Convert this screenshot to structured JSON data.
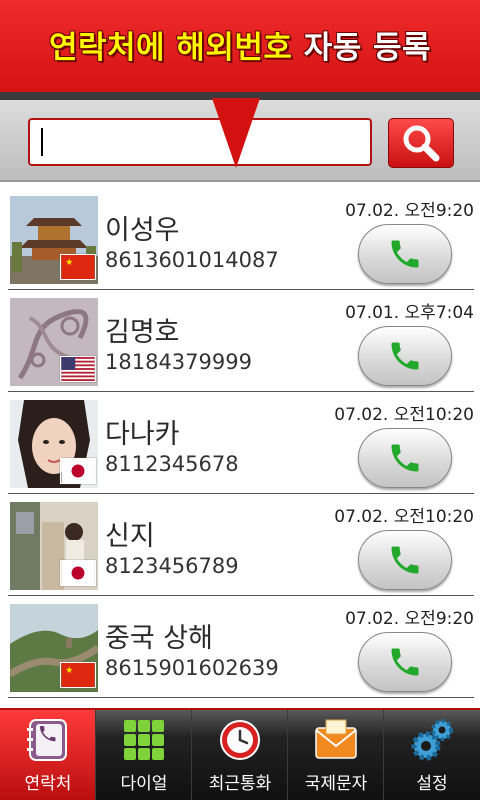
{
  "banner": {
    "title_part1": "연락처에 해외번호",
    "title_part2": "자동 등록"
  },
  "search": {
    "value": "",
    "placeholder": ""
  },
  "contacts": [
    {
      "name": "이성우",
      "number": "8613601014087",
      "time": "07.02. 오전9:20",
      "flag": "china",
      "photo": "pagoda"
    },
    {
      "name": "김명호",
      "number": "18184379999",
      "time": "07.01. 오후7:04",
      "flag": "usa",
      "photo": "pattern"
    },
    {
      "name": "다나카",
      "number": "8112345678",
      "time": "07.02. 오전10:20",
      "flag": "japan",
      "photo": "woman"
    },
    {
      "name": "신지",
      "number": "8123456789",
      "time": "07.02. 오전10:20",
      "flag": "japan",
      "photo": "street"
    },
    {
      "name": "중국  상해",
      "number": "8615901602639",
      "time": "07.02. 오전9:20",
      "flag": "china",
      "photo": "great-wall"
    }
  ],
  "tabs": [
    {
      "label": "연락처",
      "icon": "contacts-book-icon",
      "active": true
    },
    {
      "label": "다이얼",
      "icon": "dialpad-icon",
      "active": false
    },
    {
      "label": "최근통화",
      "icon": "recent-calls-clock-icon",
      "active": false
    },
    {
      "label": "국제문자",
      "icon": "envelope-icon",
      "active": false
    },
    {
      "label": "설정",
      "icon": "settings-gears-icon",
      "active": false
    }
  ],
  "colors": {
    "brand_red": "#d31111",
    "banner_text": "#fff700",
    "call_green": "#22a82a"
  }
}
